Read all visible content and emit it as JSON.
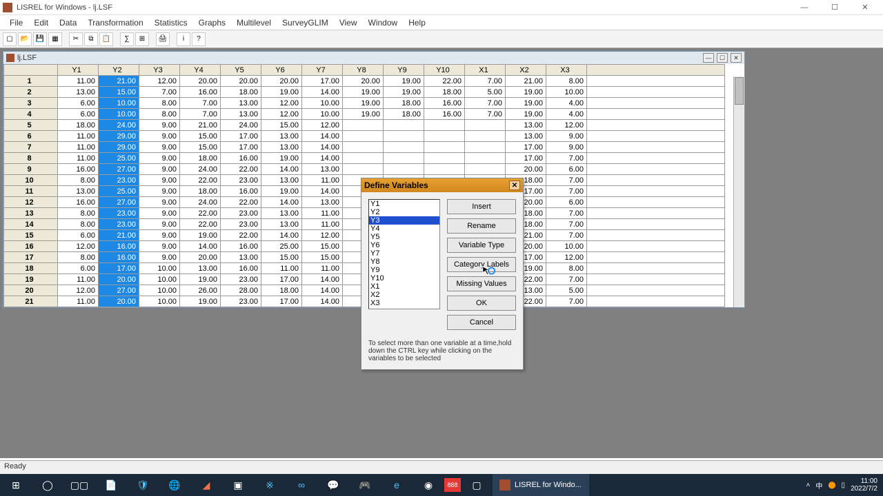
{
  "app": {
    "title": "LISREL for Windows - lj.LSF"
  },
  "menu": [
    "File",
    "Edit",
    "Data",
    "Transformation",
    "Statistics",
    "Graphs",
    "Multilevel",
    "SurveyGLIM",
    "View",
    "Window",
    "Help"
  ],
  "child": {
    "title": "lj.LSF"
  },
  "columns": [
    "Y1",
    "Y2",
    "Y3",
    "Y4",
    "Y5",
    "Y6",
    "Y7",
    "Y8",
    "Y9",
    "Y10",
    "X1",
    "X2",
    "X3"
  ],
  "selected_col_index": 1,
  "rows": [
    [
      "11.00",
      "21.00",
      "12.00",
      "20.00",
      "20.00",
      "20.00",
      "17.00",
      "20.00",
      "19.00",
      "22.00",
      "7.00",
      "21.00",
      "8.00"
    ],
    [
      "13.00",
      "15.00",
      "7.00",
      "16.00",
      "18.00",
      "19.00",
      "14.00",
      "19.00",
      "19.00",
      "18.00",
      "5.00",
      "19.00",
      "10.00"
    ],
    [
      "6.00",
      "10.00",
      "8.00",
      "7.00",
      "13.00",
      "12.00",
      "10.00",
      "19.00",
      "18.00",
      "16.00",
      "7.00",
      "19.00",
      "4.00"
    ],
    [
      "6.00",
      "10.00",
      "8.00",
      "7.00",
      "13.00",
      "12.00",
      "10.00",
      "19.00",
      "18.00",
      "16.00",
      "7.00",
      "19.00",
      "4.00"
    ],
    [
      "18.00",
      "24.00",
      "9.00",
      "21.00",
      "24.00",
      "15.00",
      "12.00",
      "",
      "",
      "",
      "",
      "13.00",
      "12.00"
    ],
    [
      "11.00",
      "29.00",
      "9.00",
      "15.00",
      "17.00",
      "13.00",
      "14.00",
      "",
      "",
      "",
      "",
      "13.00",
      "9.00"
    ],
    [
      "11.00",
      "29.00",
      "9.00",
      "15.00",
      "17.00",
      "13.00",
      "14.00",
      "",
      "",
      "",
      "",
      "17.00",
      "9.00"
    ],
    [
      "11.00",
      "25.00",
      "9.00",
      "18.00",
      "16.00",
      "19.00",
      "14.00",
      "",
      "",
      "",
      "",
      "17.00",
      "7.00"
    ],
    [
      "16.00",
      "27.00",
      "9.00",
      "24.00",
      "22.00",
      "14.00",
      "13.00",
      "",
      "",
      "",
      "",
      "20.00",
      "6.00"
    ],
    [
      "8.00",
      "23.00",
      "9.00",
      "22.00",
      "23.00",
      "13.00",
      "11.00",
      "",
      "",
      "",
      "",
      "18.00",
      "7.00"
    ],
    [
      "13.00",
      "25.00",
      "9.00",
      "18.00",
      "16.00",
      "19.00",
      "14.00",
      "",
      "",
      "",
      "",
      "17.00",
      "7.00"
    ],
    [
      "16.00",
      "27.00",
      "9.00",
      "24.00",
      "22.00",
      "14.00",
      "13.00",
      "",
      "",
      "",
      "",
      "20.00",
      "6.00"
    ],
    [
      "8.00",
      "23.00",
      "9.00",
      "22.00",
      "23.00",
      "13.00",
      "11.00",
      "",
      "",
      "",
      "",
      "18.00",
      "7.00"
    ],
    [
      "8.00",
      "23.00",
      "9.00",
      "22.00",
      "23.00",
      "13.00",
      "11.00",
      "",
      "",
      "",
      "",
      "18.00",
      "7.00"
    ],
    [
      "6.00",
      "21.00",
      "9.00",
      "19.00",
      "22.00",
      "14.00",
      "12.00",
      "",
      "",
      "",
      "",
      "21.00",
      "7.00"
    ],
    [
      "12.00",
      "16.00",
      "9.00",
      "14.00",
      "16.00",
      "25.00",
      "15.00",
      "",
      "",
      "",
      "",
      "20.00",
      "10.00"
    ],
    [
      "8.00",
      "16.00",
      "9.00",
      "20.00",
      "13.00",
      "15.00",
      "15.00",
      "",
      "",
      "",
      "",
      "17.00",
      "12.00"
    ],
    [
      "6.00",
      "17.00",
      "10.00",
      "13.00",
      "16.00",
      "11.00",
      "11.00",
      "",
      "",
      "",
      "",
      "19.00",
      "8.00"
    ],
    [
      "11.00",
      "20.00",
      "10.00",
      "19.00",
      "23.00",
      "17.00",
      "14.00",
      "",
      "",
      "",
      "",
      "22.00",
      "7.00"
    ],
    [
      "12.00",
      "27.00",
      "10.00",
      "26.00",
      "28.00",
      "18.00",
      "14.00",
      "",
      "",
      "",
      "",
      "13.00",
      "5.00"
    ],
    [
      "11.00",
      "20.00",
      "10.00",
      "19.00",
      "23.00",
      "17.00",
      "14.00",
      "",
      "",
      "",
      "",
      "22.00",
      "7.00"
    ]
  ],
  "dialog": {
    "title": "Define Variables",
    "vars": [
      "Y1",
      "Y2",
      "Y3",
      "Y4",
      "Y5",
      "Y6",
      "Y7",
      "Y8",
      "Y9",
      "Y10",
      "X1",
      "X2",
      "X3"
    ],
    "selected_var_index": 2,
    "buttons": {
      "insert": "Insert",
      "rename": "Rename",
      "vartype": "Variable Type",
      "catlabels": "Category Labels",
      "missing": "Missing Values",
      "ok": "OK",
      "cancel": "Cancel"
    },
    "hint": "To select more than one variable at a time,hold down the CTRL key while clicking on the variables to be selected"
  },
  "status": "Ready",
  "taskbar": {
    "active": "LISREL for Windo...",
    "time": "11:00",
    "date": "2022/7/2"
  }
}
